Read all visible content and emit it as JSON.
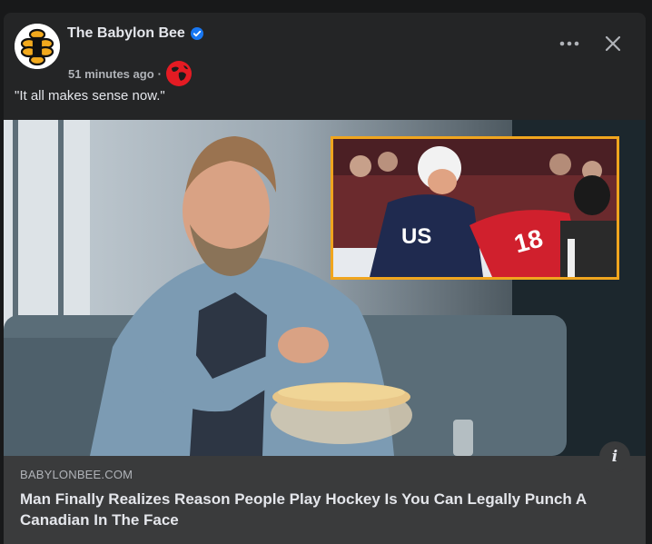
{
  "post": {
    "page_name": "The Babylon Bee",
    "timestamp": "51 minutes ago",
    "separator": "·",
    "caption": "\"It all makes sense now.\""
  },
  "link": {
    "domain": "BABYLONBEE.COM",
    "headline": "Man Finally Realizes Reason People Play Hockey Is You Can Legally Punch A Canadian In The Face"
  },
  "image": {
    "inset_jersey_left": "USA",
    "inset_jersey_right": "18"
  },
  "icons": {
    "more": "more-horizontal-icon",
    "close": "close-icon",
    "verified": "verified-badge-icon",
    "audience": "globe-icon",
    "info": "info-icon"
  },
  "colors": {
    "background": "#18191a",
    "card": "#242526",
    "link_bar": "#3a3b3c",
    "verified": "#1877f2",
    "inset_border": "#f0a51e"
  }
}
